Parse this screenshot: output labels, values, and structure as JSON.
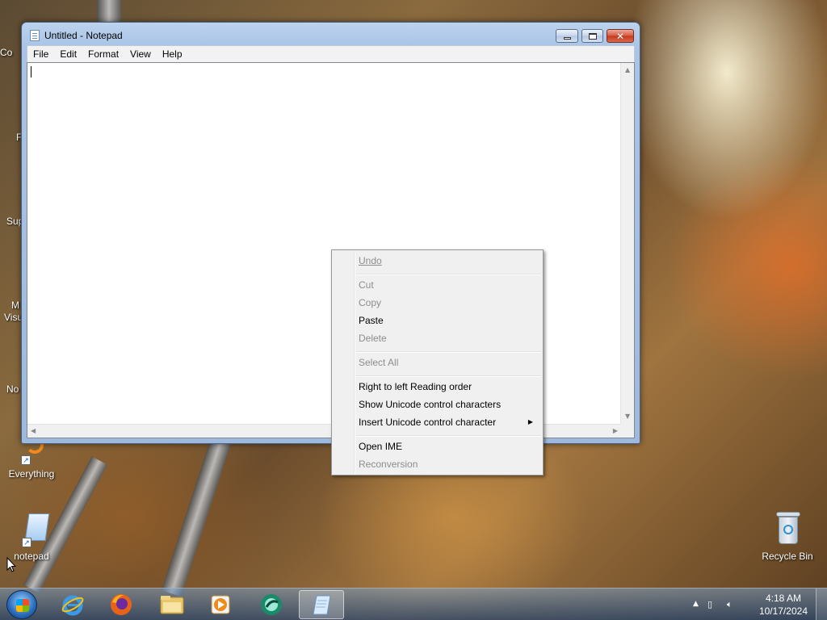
{
  "desktop": {
    "icons": [
      {
        "label": "Everything"
      },
      {
        "label": "notepad"
      },
      {
        "label": "Recycle Bin"
      }
    ],
    "partial_labels": [
      "Co",
      "F",
      "Sup",
      "M",
      "Visu",
      "No"
    ]
  },
  "window": {
    "title": "Untitled - Notepad",
    "menu": [
      "File",
      "Edit",
      "Format",
      "View",
      "Help"
    ]
  },
  "context_menu": {
    "items": [
      {
        "label": "Undo",
        "enabled": false
      },
      {
        "label": "Cut",
        "enabled": false
      },
      {
        "label": "Copy",
        "enabled": false
      },
      {
        "label": "Paste",
        "enabled": true
      },
      {
        "label": "Delete",
        "enabled": false
      },
      {
        "label": "Select All",
        "enabled": false
      },
      {
        "label": "Right to left Reading order",
        "enabled": true
      },
      {
        "label": "Show Unicode control characters",
        "enabled": true
      },
      {
        "label": "Insert Unicode control character",
        "enabled": true,
        "submenu": true
      },
      {
        "label": "Open IME",
        "enabled": true
      },
      {
        "label": "Reconversion",
        "enabled": false
      }
    ]
  },
  "taskbar": {
    "pinned": [
      "internet-explorer-icon",
      "firefox-icon",
      "file-explorer-icon",
      "media-player-icon",
      "app-icon",
      "notepad-icon"
    ],
    "clock": {
      "time": "4:18 AM",
      "date": "10/17/2024"
    }
  }
}
